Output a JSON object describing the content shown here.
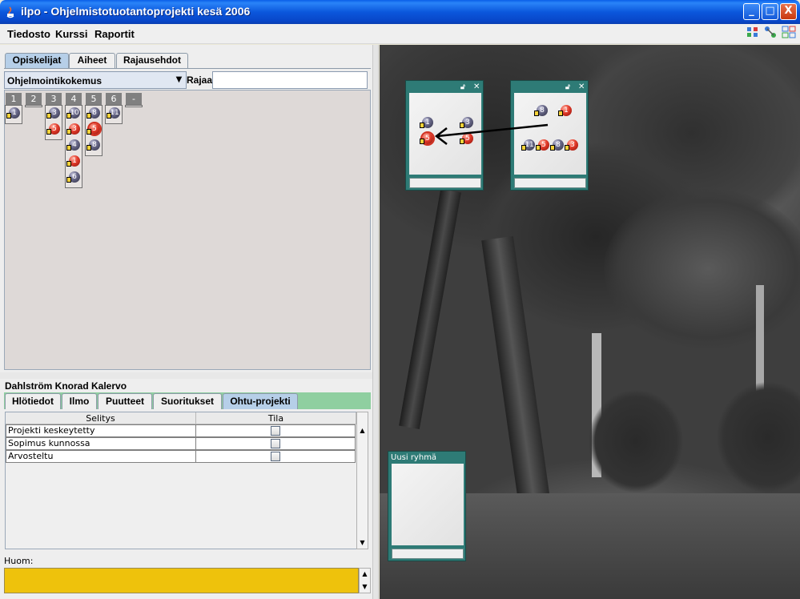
{
  "window": {
    "title": "ilpo - Ohjelmistotuotantoprojekti kesä 2006"
  },
  "window_buttons": {
    "minimize": "_",
    "maximize": "□",
    "close": "X"
  },
  "menu": {
    "items": [
      "Tiedosto",
      "Kurssi",
      "Raportit"
    ]
  },
  "toolbar_icons": [
    "grid-view-icon",
    "link-icon",
    "layout-icon"
  ],
  "left_tabs": {
    "items": [
      "Opiskelijat",
      "Aiheet",
      "Rajausehdot"
    ],
    "active": "Opiskelijat"
  },
  "filter": {
    "selected": "Ohjelmointikokemus",
    "rajaa_label": "Rajaa",
    "rajaa_value": ""
  },
  "columns": [
    "1",
    "2",
    "3",
    "4",
    "5",
    "6",
    "-"
  ],
  "student_columns": [
    {
      "marbles": [
        {
          "n": "1",
          "c": "b"
        }
      ]
    },
    {
      "marbles": []
    },
    {
      "marbles": [
        {
          "n": "3",
          "c": "b"
        },
        {
          "n": "5",
          "c": "r"
        }
      ]
    },
    {
      "marbles": [
        {
          "n": "10",
          "c": "b"
        },
        {
          "n": "3",
          "c": "r"
        },
        {
          "n": "4",
          "c": "b"
        },
        {
          "n": "1",
          "c": "r"
        },
        {
          "n": "6",
          "c": "b"
        }
      ]
    },
    {
      "marbles": [
        {
          "n": "8",
          "c": "b"
        },
        {
          "n": "5",
          "c": "r"
        },
        {
          "n": "8",
          "c": "b"
        }
      ]
    },
    {
      "marbles": [
        {
          "n": "11",
          "c": "b"
        }
      ]
    },
    {
      "marbles": []
    }
  ],
  "student": {
    "name": "Dahlström Knorad Kalervo"
  },
  "detail_tabs": {
    "items": [
      "Hlötiedot",
      "Ilmo",
      "Puutteet",
      "Suoritukset",
      "Ohtu-projekti"
    ],
    "active": "Ohtu-projekti"
  },
  "table": {
    "headers": [
      "Selitys",
      "Tila"
    ],
    "rows": [
      {
        "label": "Projekti keskeytetty",
        "checked": false
      },
      {
        "label": "Sopimus kunnossa",
        "checked": false
      },
      {
        "label": "Arvosteltu",
        "checked": false
      }
    ]
  },
  "huom": {
    "label": "Huom:",
    "value": ""
  },
  "groups": [
    {
      "title": "",
      "marbles": [
        {
          "n": "1",
          "c": "b"
        },
        {
          "n": "3",
          "c": "b"
        },
        {
          "n": "5",
          "c": "r"
        },
        {
          "n": "5",
          "c": "r"
        }
      ]
    },
    {
      "title": "",
      "marbles": [
        {
          "n": "8",
          "c": "b"
        },
        {
          "n": "1",
          "c": "r"
        },
        {
          "n": "11",
          "c": "b"
        },
        {
          "n": "5",
          "c": "r"
        },
        {
          "n": "8",
          "c": "b"
        },
        {
          "n": "3",
          "c": "r"
        }
      ]
    },
    {
      "title": "Uusi ryhmä",
      "marbles": []
    }
  ],
  "colors": {
    "titlebar": "#0b57dc",
    "group_window": "#2e7b76",
    "huom_bg": "#eec20c",
    "tab_active": "#b6cfe8",
    "tabs_strip": "#8fcfa0"
  }
}
